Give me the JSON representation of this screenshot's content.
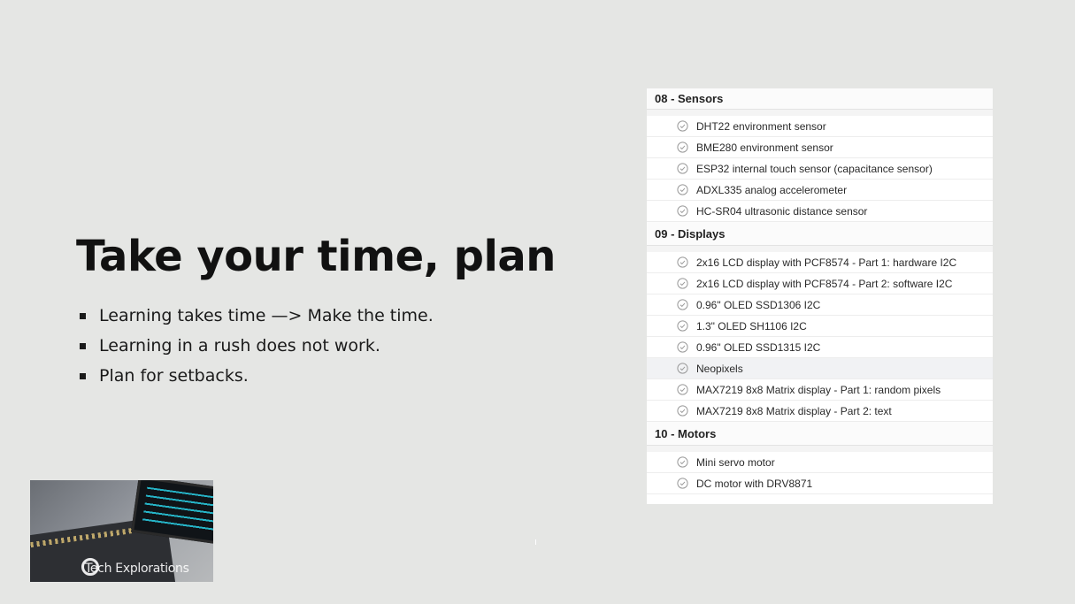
{
  "slide": {
    "title": "Take your time, plan",
    "bullets": [
      "Learning takes time —> Make the time.",
      "Learning in a rush does not work.",
      "Plan for setbacks."
    ]
  },
  "outline": {
    "sections": [
      {
        "title": "08 - Sensors",
        "lectures": [
          "DHT22 environment sensor",
          "BME280 environment sensor",
          "ESP32 internal touch sensor (capacitance sensor)",
          "ADXL335 analog accelerometer",
          "HC-SR04 ultrasonic distance sensor"
        ]
      },
      {
        "title": "09 - Displays",
        "lectures": [
          "2x16 LCD display with PCF8574 - Part 1: hardware I2C",
          "2x16 LCD display with PCF8574 - Part 2: software I2C",
          "0.96\" OLED SSD1306 I2C",
          "1.3\" OLED SH1106 I2C",
          "0.96\" OLED SSD1315 I2C",
          "Neopixels",
          "MAX7219 8x8 Matrix display - Part 1: random pixels",
          "MAX7219 8x8 Matrix display - Part 2: text"
        ]
      },
      {
        "title": "10 - Motors",
        "lectures": [
          "Mini servo motor",
          "DC motor with DRV8871"
        ]
      }
    ],
    "icon": "check-circle-icon"
  },
  "thumbnail": {
    "logo_text": "Tech Explorations"
  },
  "colors": {
    "background": "#e5e6e4",
    "panel": "#ffffff",
    "check_icon": "#9a9a9a",
    "screen_text": "#2ad0e6"
  }
}
